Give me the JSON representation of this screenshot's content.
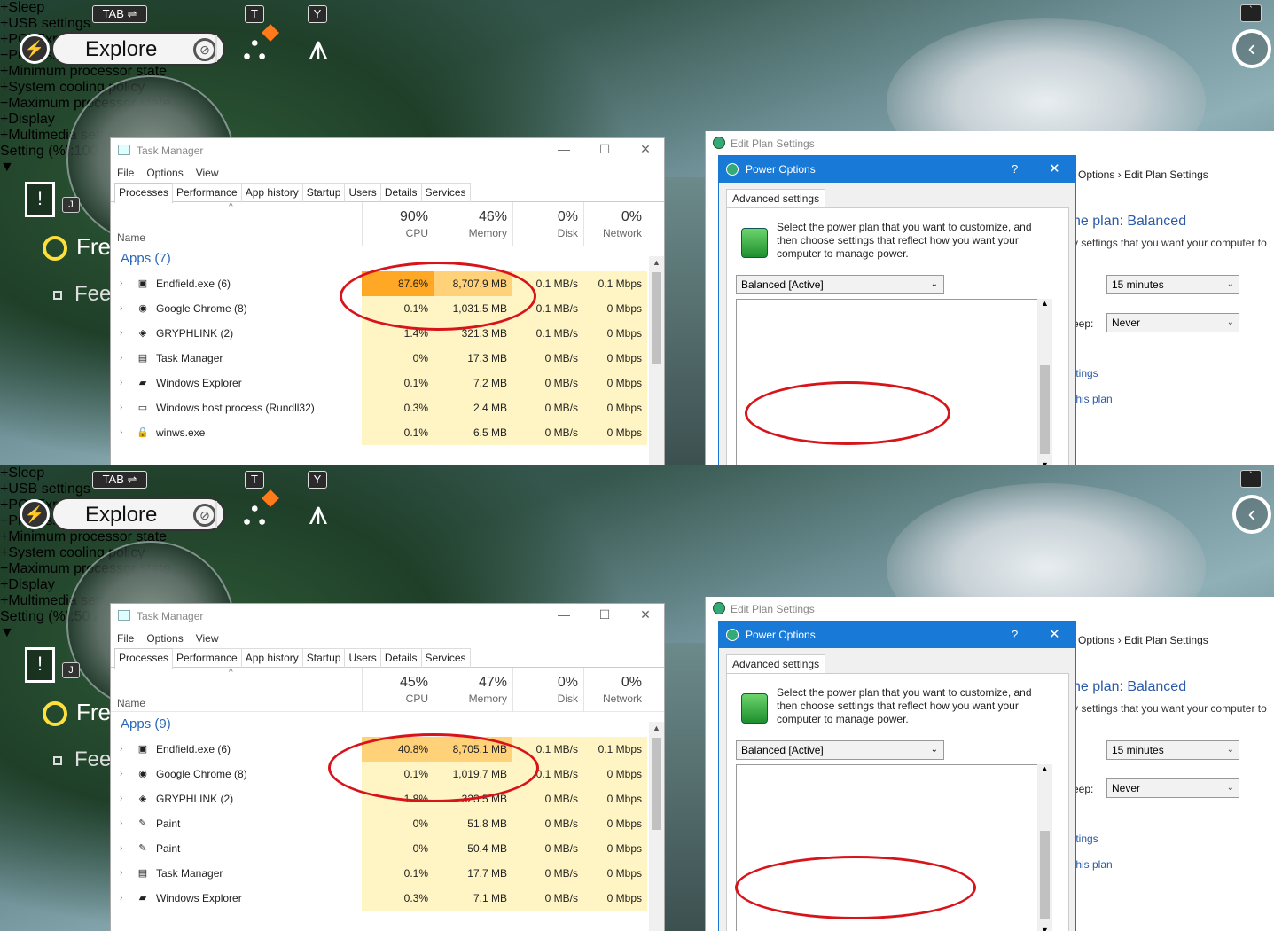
{
  "game": {
    "tab_key": "TAB ⇌",
    "t_key": "T",
    "y_key": "Y",
    "mode_label": "Explore",
    "j_key": "J",
    "objective_1": "Fre",
    "objective_2": "Fee",
    "top_key": "`"
  },
  "task_manager": {
    "title": "Task Manager",
    "menu": [
      "File",
      "Options",
      "View"
    ],
    "tabs": [
      "Processes",
      "Performance",
      "App history",
      "Startup",
      "Users",
      "Details",
      "Services"
    ],
    "name_header": "Name",
    "col_labels": [
      "CPU",
      "Memory",
      "Disk",
      "Network"
    ]
  },
  "power": {
    "edit_plan_title": "Edit Plan Settings",
    "breadcrumb": "Options  ›  Edit Plan Settings",
    "plan_heading": "he plan: Balanced",
    "plan_desc": "y settings that you want your computer to",
    "sel_1": "15 minutes",
    "leep_label": "eep:",
    "sel_2": "Never",
    "link_1": "ttings",
    "link_2": "this plan",
    "dialog_title": "Power Options",
    "help": "?",
    "close": "✕",
    "tab": "Advanced settings",
    "description": "Select the power plan that you want to customize, and then choose settings that reflect how you want your computer to manage power.",
    "plan_select": "Balanced [Active]",
    "tree": [
      "Sleep",
      "USB settings",
      "PCI Express",
      "Processor power management",
      "Minimum processor state",
      "System cooling policy",
      "Maximum processor state",
      "Display",
      "Multimedia settings"
    ],
    "setting_label": "Setting (%):"
  },
  "top": {
    "cpu_pct": "90%",
    "mem_pct": "46%",
    "disk_pct": "0%",
    "net_pct": "0%",
    "group": "Apps (7)",
    "rows": [
      {
        "name": "Endfield.exe (6)",
        "cpu": "87.6%",
        "mem": "8,707.9 MB",
        "disk": "0.1 MB/s",
        "net": "0.1 Mbps"
      },
      {
        "name": "Google Chrome (8)",
        "cpu": "0.1%",
        "mem": "1,031.5 MB",
        "disk": "0.1 MB/s",
        "net": "0 Mbps"
      },
      {
        "name": "GRYPHLINK (2)",
        "cpu": "1.4%",
        "mem": "321.3 MB",
        "disk": "0.1 MB/s",
        "net": "0 Mbps"
      },
      {
        "name": "Task Manager",
        "cpu": "0%",
        "mem": "17.3 MB",
        "disk": "0 MB/s",
        "net": "0 Mbps"
      },
      {
        "name": "Windows Explorer",
        "cpu": "0.1%",
        "mem": "7.2 MB",
        "disk": "0 MB/s",
        "net": "0 Mbps"
      },
      {
        "name": "Windows host process (Rundll32)",
        "cpu": "0.3%",
        "mem": "2.4 MB",
        "disk": "0 MB/s",
        "net": "0 Mbps"
      },
      {
        "name": "winws.exe",
        "cpu": "0.1%",
        "mem": "6.5 MB",
        "disk": "0 MB/s",
        "net": "0 Mbps"
      }
    ],
    "max_setting": "100"
  },
  "bottom": {
    "cpu_pct": "45%",
    "mem_pct": "47%",
    "disk_pct": "0%",
    "net_pct": "0%",
    "group": "Apps (9)",
    "rows": [
      {
        "name": "Endfield.exe (6)",
        "cpu": "40.8%",
        "mem": "8,705.1 MB",
        "disk": "0.1 MB/s",
        "net": "0.1 Mbps"
      },
      {
        "name": "Google Chrome (8)",
        "cpu": "0.1%",
        "mem": "1,019.7 MB",
        "disk": "0.1 MB/s",
        "net": "0 Mbps"
      },
      {
        "name": "GRYPHLINK (2)",
        "cpu": "1.8%",
        "mem": "323.5 MB",
        "disk": "0 MB/s",
        "net": "0 Mbps"
      },
      {
        "name": "Paint",
        "cpu": "0%",
        "mem": "51.8 MB",
        "disk": "0 MB/s",
        "net": "0 Mbps"
      },
      {
        "name": "Paint",
        "cpu": "0%",
        "mem": "50.4 MB",
        "disk": "0 MB/s",
        "net": "0 Mbps"
      },
      {
        "name": "Task Manager",
        "cpu": "0.1%",
        "mem": "17.7 MB",
        "disk": "0 MB/s",
        "net": "0 Mbps"
      },
      {
        "name": "Windows Explorer",
        "cpu": "0.3%",
        "mem": "7.1 MB",
        "disk": "0 MB/s",
        "net": "0 Mbps"
      }
    ],
    "max_setting": "50"
  },
  "colors": {
    "cpu_hot": "#ffa825",
    "cell": "#fff4c4",
    "accent": "#1979d6",
    "highlight_ring": "#d8141b"
  }
}
